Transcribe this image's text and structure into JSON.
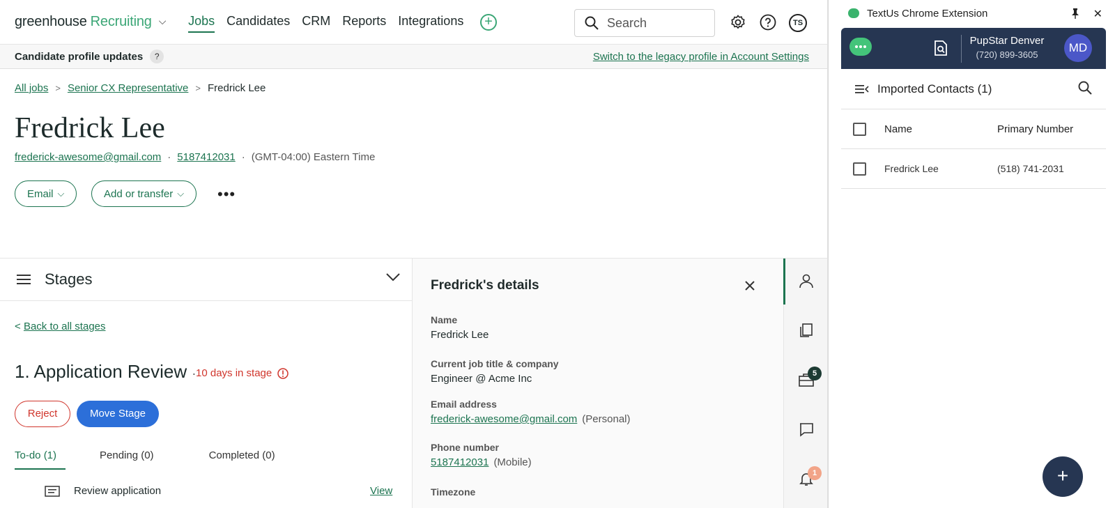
{
  "nav": {
    "logo_main": "greenhouse",
    "logo_sub": "Recruiting",
    "links": [
      "Jobs",
      "Candidates",
      "CRM",
      "Reports",
      "Integrations"
    ],
    "search_placeholder": "Search",
    "user_initials": "TS"
  },
  "banner": {
    "title": "Candidate profile updates",
    "help": "?",
    "legacy_link": "Switch to the legacy profile in Account Settings"
  },
  "breadcrumb": [
    "All jobs",
    "Senior CX Representative",
    "Fredrick Lee"
  ],
  "candidate": {
    "name": "Fredrick Lee",
    "email": "frederick-awesome@gmail.com",
    "phone": "5187412031",
    "timezone": "(GMT-04:00) Eastern Time",
    "email_btn": "Email",
    "transfer_btn": "Add or transfer",
    "more": "•••"
  },
  "stages": {
    "title": "Stages",
    "back": "Back to all stages",
    "current": "1. Application Review",
    "days": "10 days in stage",
    "reject": "Reject",
    "move": "Move Stage",
    "tabs": [
      "To-do (1)",
      "Pending (0)",
      "Completed (0)"
    ],
    "task": "Review application",
    "view": "View"
  },
  "details": {
    "title": "Fredrick's details",
    "name_label": "Name",
    "name_value": "Fredrick Lee",
    "job_label": "Current job title & company",
    "job_value": "Engineer @ Acme Inc",
    "email_label": "Email address",
    "email_value": "frederick-awesome@gmail.com",
    "email_type": "(Personal)",
    "phone_label": "Phone number",
    "phone_value": "5187412031",
    "phone_type": "(Mobile)",
    "tz_label": "Timezone"
  },
  "rail": {
    "jobs_badge": "5",
    "alerts_badge": "1"
  },
  "ext": {
    "title": "TextUs Chrome Extension",
    "account_name": "PupStar Denver",
    "account_phone": "(720) 899-3605",
    "avatar": "MD",
    "list_title": "Imported Contacts (1)",
    "col_name": "Name",
    "col_phone": "Primary Number",
    "rows": [
      {
        "name": "Fredrick Lee",
        "phone": "(518) 741-2031"
      }
    ],
    "fab": "+"
  },
  "colors": {
    "brand": "#1c7450",
    "brand_light": "#3ba676",
    "danger": "#d0352c",
    "primary": "#2c6fd9",
    "ext_navy": "#263652"
  }
}
